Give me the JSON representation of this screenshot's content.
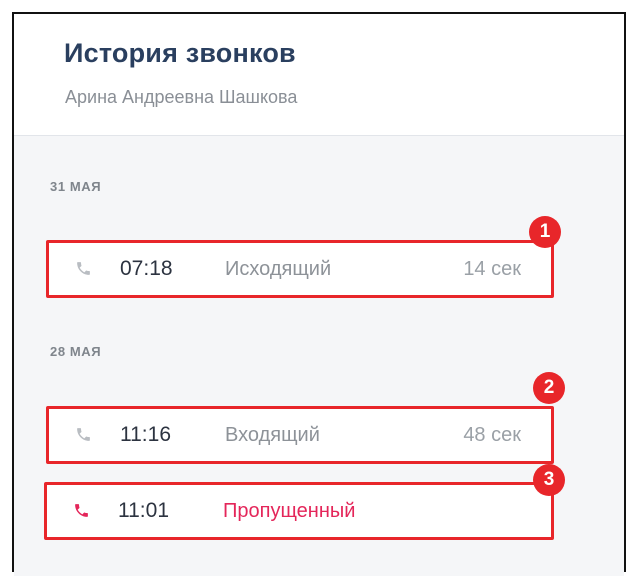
{
  "header": {
    "title": "История звонков",
    "subtitle": "Арина Андреевна Шашкова"
  },
  "groups": [
    {
      "date": "31 МАЯ",
      "calls": [
        {
          "time": "07:18",
          "type": "Исходящий",
          "duration": "14 сек",
          "status": "outgoing",
          "badge": "1"
        }
      ]
    },
    {
      "date": "28 МАЯ",
      "calls": [
        {
          "time": "11:16",
          "type": "Входящий",
          "duration": "48 сек",
          "status": "incoming",
          "badge": "2"
        },
        {
          "time": "11:01",
          "type": "Пропущенный",
          "duration": "",
          "status": "missed",
          "badge": "3"
        }
      ]
    }
  ],
  "colors": {
    "title": "#2a3f5f",
    "missed": "#e4265a",
    "highlight": "#e8262a",
    "phone_icon_muted": "#b9bdc2"
  },
  "icons": {
    "call_icon": "phone-icon"
  }
}
